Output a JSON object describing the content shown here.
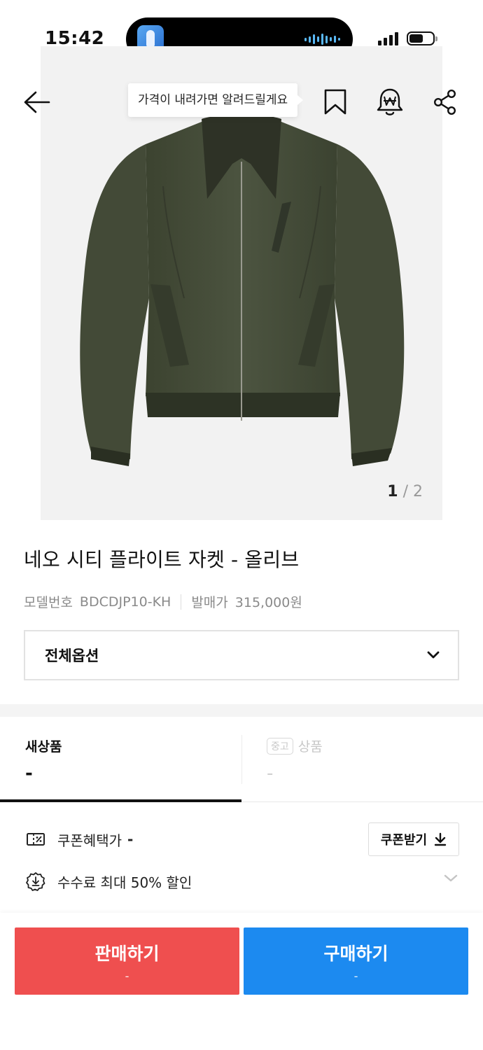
{
  "status_bar": {
    "time": "15:42"
  },
  "nav": {
    "tooltip": "가격이 내려가면 알려드릴게요",
    "icons": [
      "back-arrow-icon",
      "bookmark-icon",
      "price-alert-bell-icon",
      "share-icon"
    ]
  },
  "gallery": {
    "current": "1",
    "separator": " / ",
    "total": "2"
  },
  "product": {
    "title": "네오 시티 플라이트 자켓 - 올리브",
    "model_label": "모델번호",
    "model_value": "BDCDJP10-KH",
    "release_price_label": "발매가",
    "release_price_value": "315,000원"
  },
  "option_select": {
    "label": "전체옵션"
  },
  "condition_tabs": {
    "new": {
      "label": "새상품",
      "price": "-"
    },
    "used": {
      "badge": "중고",
      "label": "상품",
      "price": "-"
    }
  },
  "benefits": {
    "coupon_price_label": "쿠폰혜택가",
    "coupon_price_value": "-",
    "coupon_button": "쿠폰받기",
    "fee_text": "수수료 최대 50% 할인"
  },
  "actions": {
    "sell": {
      "label": "판매하기",
      "price": "-",
      "color": "#ef4f4f"
    },
    "buy": {
      "label": "구매하기",
      "price": "-",
      "color": "#1c8af0"
    }
  }
}
